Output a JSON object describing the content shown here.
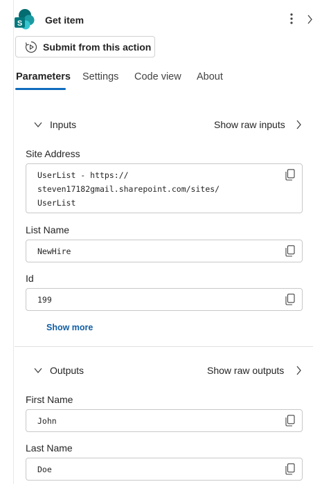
{
  "header": {
    "title": "Get item"
  },
  "submit_button": {
    "label": "Submit from this action"
  },
  "tabs": [
    {
      "label": "Parameters",
      "active": true
    },
    {
      "label": "Settings"
    },
    {
      "label": "Code view"
    },
    {
      "label": "About"
    }
  ],
  "inputs": {
    "label": "Inputs",
    "raw_link": "Show raw inputs",
    "fields": [
      {
        "label": "Site Address",
        "value": "UserList - https://\nsteven17182gmail.sharepoint.com/sites/\nUserList"
      },
      {
        "label": "List Name",
        "value": "NewHire"
      },
      {
        "label": "Id",
        "value": "199"
      }
    ],
    "show_more": "Show more"
  },
  "outputs": {
    "label": "Outputs",
    "raw_link": "Show raw outputs",
    "fields": [
      {
        "label": "First Name",
        "value": "John"
      },
      {
        "label": "Last Name",
        "value": "Doe"
      }
    ]
  },
  "colors": {
    "accent": "#0f6cbd",
    "link": "#115ea3",
    "sharepoint": "#038387"
  },
  "icons": [
    "sharepoint-icon",
    "more-vertical-icon",
    "chevron-right-icon",
    "submit-play-icon",
    "chevron-down-icon",
    "copy-icon"
  ]
}
